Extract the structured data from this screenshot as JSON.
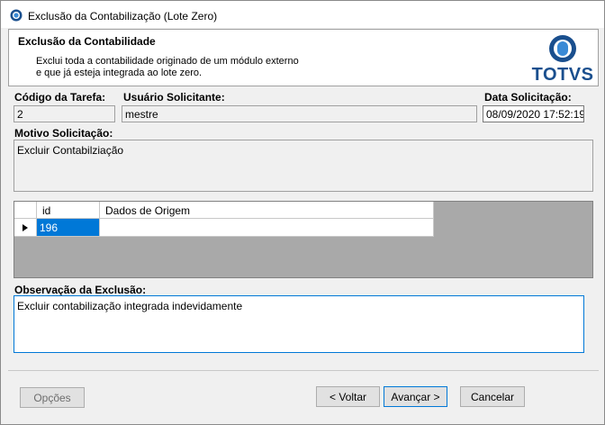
{
  "window": {
    "title": "Exclusão da Contabilização (Lote Zero)"
  },
  "header": {
    "title": "Exclusão da Contabilidade",
    "description_line1": "Exclui toda a contabilidade originado de um módulo externo",
    "description_line2": "e que já esteja integrada ao lote zero.",
    "logo_text": "TOTVS",
    "logo_color": "#1a4f8e"
  },
  "form": {
    "codigo_label": "Código da Tarefa:",
    "codigo_value": "2",
    "usuario_label": "Usuário Solicitante:",
    "usuario_value": "mestre",
    "data_label": "Data Solicitação:",
    "data_value": "08/09/2020 17:52:19",
    "motivo_label": "Motivo Solicitação:",
    "motivo_value": "Excluir Contabilziação",
    "observacao_label": "Observação da Exclusão:",
    "observacao_value": "Excluir contabilização integrada indevidamente"
  },
  "grid": {
    "columns": [
      "id",
      "Dados de Origem"
    ],
    "rows": [
      {
        "id": "196",
        "dados": ""
      }
    ],
    "selection_color": "#0078d7"
  },
  "buttons": {
    "opcoes": "Opções",
    "voltar": "< Voltar",
    "avancar": "Avançar >",
    "cancelar": "Cancelar"
  }
}
